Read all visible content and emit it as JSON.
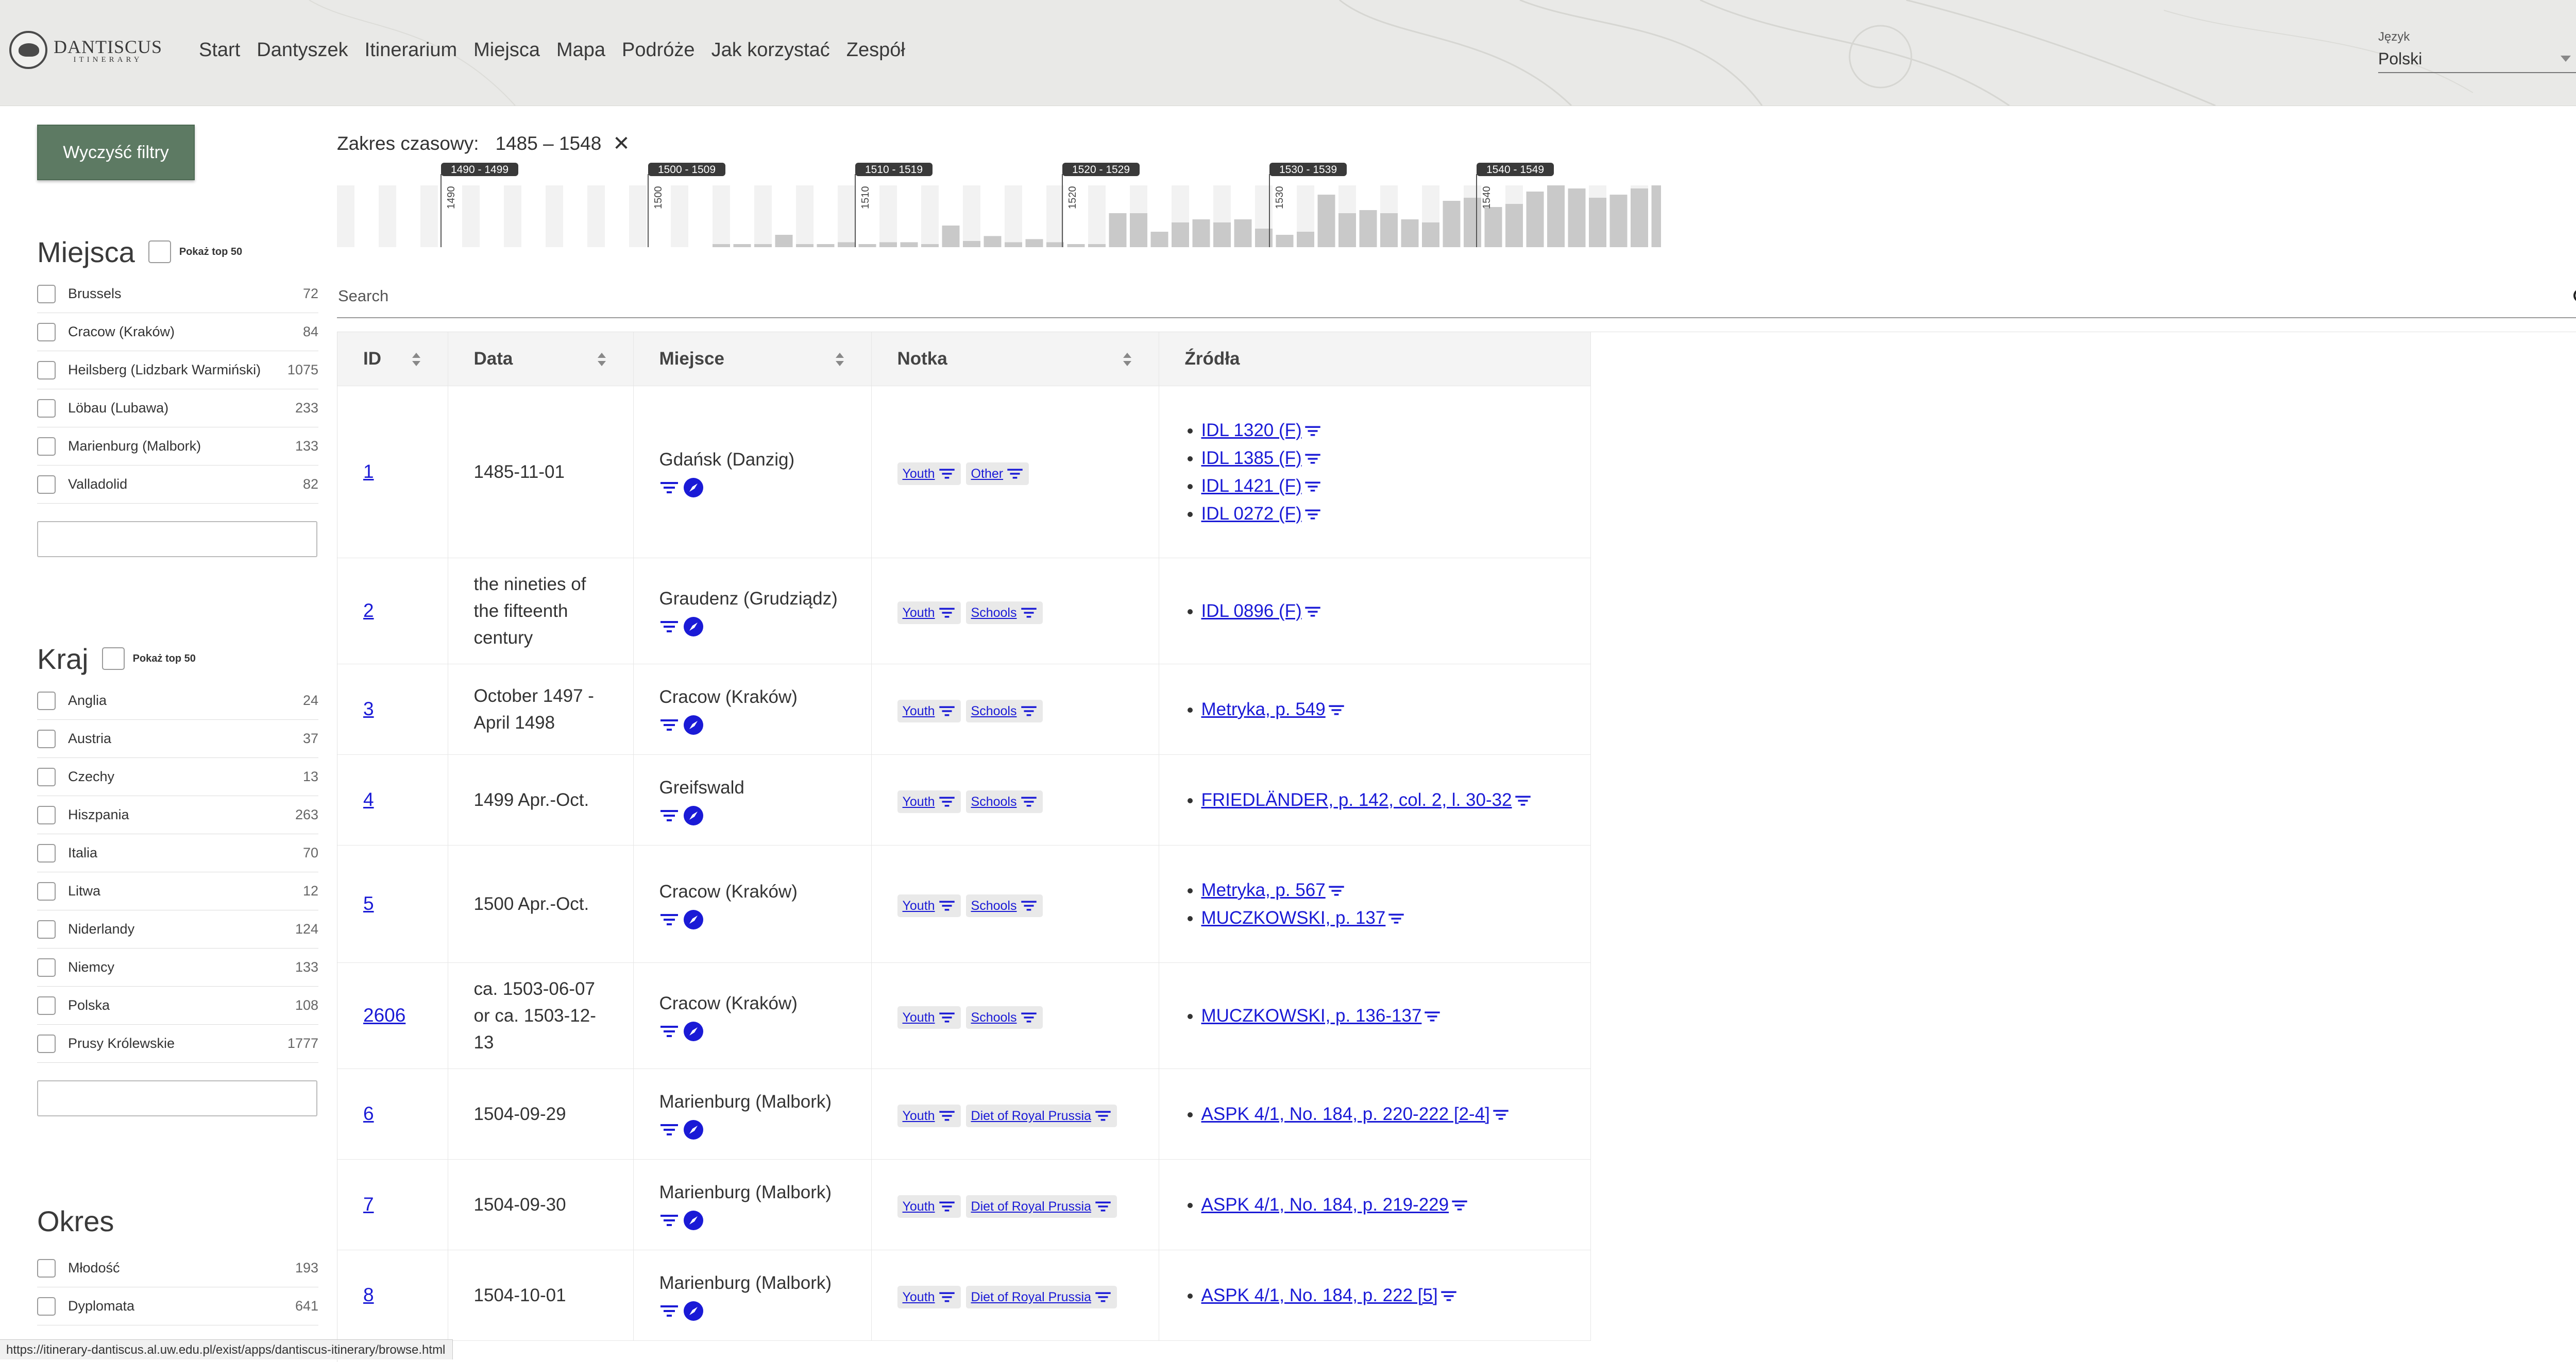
{
  "header": {
    "logo_title": "DANTISCUS",
    "logo_subtitle": "ITINERARY",
    "nav": [
      "Start",
      "Dantyszek",
      "Itinerarium",
      "Miejsca",
      "Mapa",
      "Podróże",
      "Jak korzystać",
      "Zespół"
    ],
    "language_label": "Język",
    "language_value": "Polski",
    "theme_icon": "sun-icon"
  },
  "sidebar": {
    "clear_filters": "Wyczyść filtry",
    "places": {
      "title": "Miejsca",
      "top50_label": "Pokaż top 50",
      "items": [
        {
          "label": "Brussels",
          "count": "72"
        },
        {
          "label": "Cracow (Kraków)",
          "count": "84"
        },
        {
          "label": "Heilsberg (Lidzbark Warmiński)",
          "count": "1075"
        },
        {
          "label": "Löbau (Lubawa)",
          "count": "233"
        },
        {
          "label": "Marienburg (Malbork)",
          "count": "133"
        },
        {
          "label": "Valladolid",
          "count": "82"
        }
      ]
    },
    "country": {
      "title": "Kraj",
      "top50_label": "Pokaż top 50",
      "items": [
        {
          "label": "Anglia",
          "count": "24"
        },
        {
          "label": "Austria",
          "count": "37"
        },
        {
          "label": "Czechy",
          "count": "13"
        },
        {
          "label": "Hiszpania",
          "count": "263"
        },
        {
          "label": "Italia",
          "count": "70"
        },
        {
          "label": "Litwa",
          "count": "12"
        },
        {
          "label": "Niderlandy",
          "count": "124"
        },
        {
          "label": "Niemcy",
          "count": "133"
        },
        {
          "label": "Polska",
          "count": "108"
        },
        {
          "label": "Prusy Królewskie",
          "count": "1777"
        }
      ]
    },
    "period": {
      "title": "Okres",
      "items": [
        {
          "label": "Młodość",
          "count": "193"
        },
        {
          "label": "Dyplomata",
          "count": "641"
        }
      ]
    }
  },
  "time_range": {
    "label": "Zakres czasowy:",
    "value": "1485 – 1548",
    "clear_icon": "close-icon",
    "decades": [
      "1490 - 1499",
      "1500 - 1509",
      "1510 - 1519",
      "1520 - 1529",
      "1530 - 1539",
      "1540 - 1549"
    ],
    "decade_ticks": [
      "1490",
      "1500",
      "1510",
      "1520",
      "1530",
      "1540"
    ],
    "bar_levels": [
      0,
      0,
      0,
      0,
      0,
      0,
      0,
      0,
      0,
      0,
      0,
      0,
      0,
      0,
      0,
      0,
      0,
      0,
      0.05,
      0.05,
      0.05,
      0.2,
      0.05,
      0.05,
      0.08,
      0.05,
      0.08,
      0.08,
      0.05,
      0.35,
      0.1,
      0.18,
      0.08,
      0.13,
      0.08,
      0.05,
      0.05,
      0.55,
      0.55,
      0.25,
      0.4,
      0.45,
      0.4,
      0.45,
      0.3,
      0.2,
      0.25,
      0.85,
      0.55,
      0.6,
      0.55,
      0.45,
      0.4,
      0.75,
      0.8,
      0.65,
      0.7,
      0.9,
      1,
      0.95,
      0.8,
      0.85,
      0.95,
      1,
      0.75
    ]
  },
  "search": {
    "placeholder": "Search"
  },
  "table": {
    "columns": [
      "ID",
      "Data",
      "Miejsce",
      "Notka",
      "Źródła"
    ],
    "rows": [
      {
        "id": "1",
        "date": [
          "1485-11-01"
        ],
        "place": "Gdańsk (Danzig)",
        "tags": [
          "Youth",
          "Other"
        ],
        "sources": [
          "IDL 1320 (F)",
          "IDL 1385 (F)",
          "IDL 1421 (F)",
          "IDL 0272 (F)"
        ]
      },
      {
        "id": "2",
        "date": [
          "the nineties of",
          "the fifteenth",
          "century"
        ],
        "place": "Graudenz (Grudziądz)",
        "tags": [
          "Youth",
          "Schools"
        ],
        "sources": [
          "IDL 0896 (F)"
        ]
      },
      {
        "id": "3",
        "date": [
          "October 1497 -",
          "April 1498"
        ],
        "place": "Cracow (Kraków)",
        "tags": [
          "Youth",
          "Schools"
        ],
        "sources": [
          "Metryka, p. 549"
        ]
      },
      {
        "id": "4",
        "date": [
          "1499 Apr.-Oct."
        ],
        "place": "Greifswald",
        "tags": [
          "Youth",
          "Schools"
        ],
        "sources": [
          "FRIEDLÄNDER, p. 142, col. 2, l. 30-32"
        ]
      },
      {
        "id": "5",
        "date": [
          "1500 Apr.-Oct."
        ],
        "place": "Cracow (Kraków)",
        "tags": [
          "Youth",
          "Schools"
        ],
        "sources": [
          "Metryka, p. 567",
          "MUCZKOWSKI, p. 137"
        ]
      },
      {
        "id": "2606",
        "date": [
          "ca. 1503-06-07",
          "or ca. 1503-12-",
          "13"
        ],
        "place": "Cracow (Kraków)",
        "tags": [
          "Youth",
          "Schools"
        ],
        "sources": [
          "MUCZKOWSKI, p. 136-137"
        ]
      },
      {
        "id": "6",
        "date": [
          "1504-09-29"
        ],
        "place": "Marienburg (Malbork)",
        "tags": [
          "Youth",
          "Diet of Royal Prussia"
        ],
        "sources": [
          "ASPK 4/1, No. 184, p. 220-222 [2-4]"
        ]
      },
      {
        "id": "7",
        "date": [
          "1504-09-30"
        ],
        "place": "Marienburg (Malbork)",
        "tags": [
          "Youth",
          "Diet of Royal Prussia"
        ],
        "sources": [
          "ASPK 4/1, No. 184, p. 219-229"
        ]
      },
      {
        "id": "8",
        "date": [
          "1504-10-01"
        ],
        "place": "Marienburg (Malbork)",
        "tags": [
          "Youth",
          "Diet of Royal Prussia"
        ],
        "sources": [
          "ASPK 4/1, No. 184, p. 222 [5]"
        ]
      }
    ]
  },
  "status_url": "https://itinerary-dantiscus.al.uw.edu.pl/exist/apps/dantiscus-itinerary/browse.html"
}
